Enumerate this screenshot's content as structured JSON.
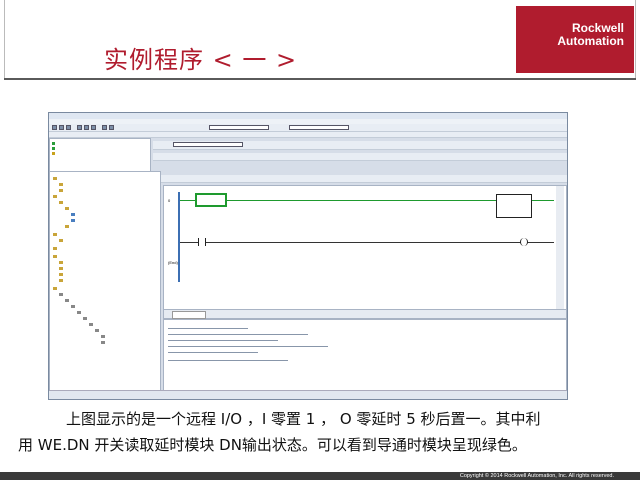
{
  "slide": {
    "title": "实例程序 < 一 >",
    "logo_line1": "Rockwell",
    "logo_line2": "Automation",
    "caption_line1": "上图显示的是一个远程 I/O ，I 零置 1 ， O 零延时 5 秒后置一。其中利",
    "caption_line2": "用 WE.DN 开关读取延时模块 DN输出状态。可以看到导通时模块呈现绿色。",
    "copyright": "Copyright © 2014 Rockwell Automation, Inc. All rights reserved."
  },
  "colors": {
    "accent": "#b01c2e",
    "rung_active": "#1e9a2e"
  },
  "screenshot": {
    "kind": "RSLogix 5000 ladder editor with controller organizer tree and output pane",
    "ladder_rung_start": "0",
    "ladder_rung_end": "(End)"
  }
}
